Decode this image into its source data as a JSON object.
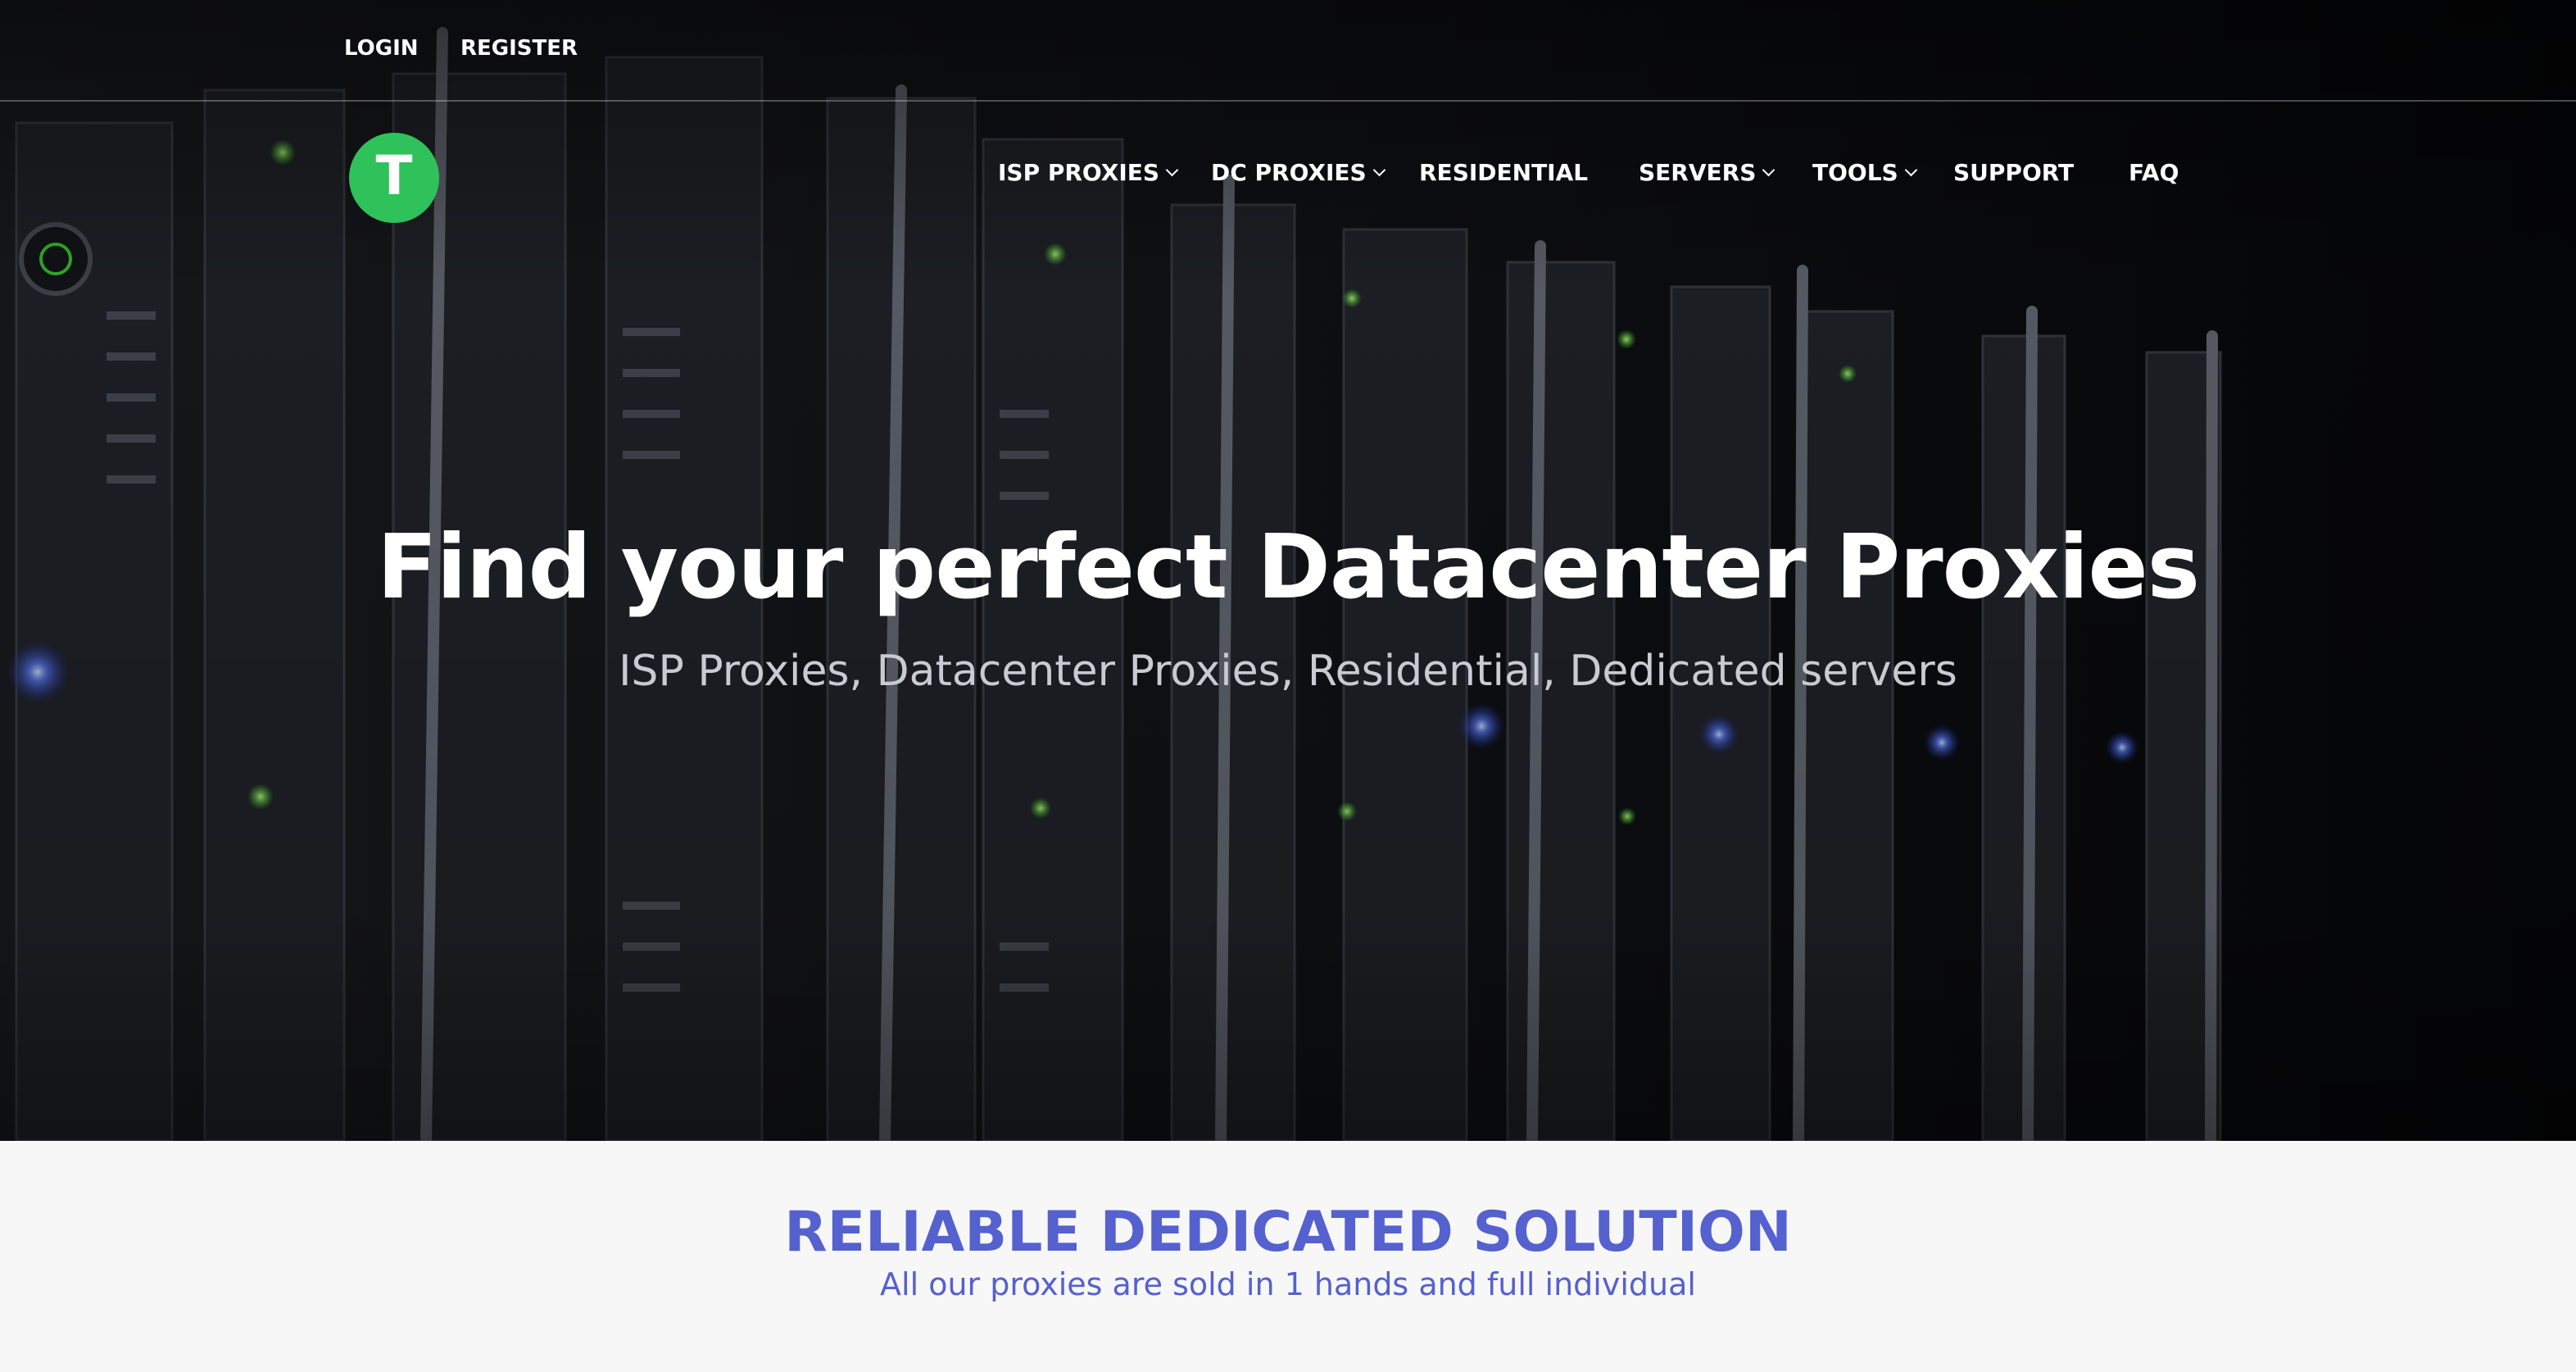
{
  "topbar": {
    "login_label": "LOGIN",
    "register_label": "REGISTER"
  },
  "logo": {
    "letter": "T",
    "color": "#2fc25b"
  },
  "nav": {
    "items": [
      {
        "label": "ISP PROXIES",
        "has_dropdown": true
      },
      {
        "label": "DC PROXIES",
        "has_dropdown": true
      },
      {
        "label": "RESIDENTIAL",
        "has_dropdown": false
      },
      {
        "label": "SERVERS",
        "has_dropdown": true
      },
      {
        "label": "TOOLS",
        "has_dropdown": true
      },
      {
        "label": "SUPPORT",
        "has_dropdown": false
      },
      {
        "label": "FAQ",
        "has_dropdown": false
      }
    ]
  },
  "hero": {
    "title": "Find your perfect Datacenter Proxies",
    "subtitle": "ISP Proxies, Datacenter Proxies, Residential, Dedicated servers"
  },
  "section": {
    "title": "RELIABLE DEDICATED SOLUTION",
    "subtitle": "All our proxies are sold in 1 hands and full individual",
    "accent_color": "#5561cf"
  }
}
